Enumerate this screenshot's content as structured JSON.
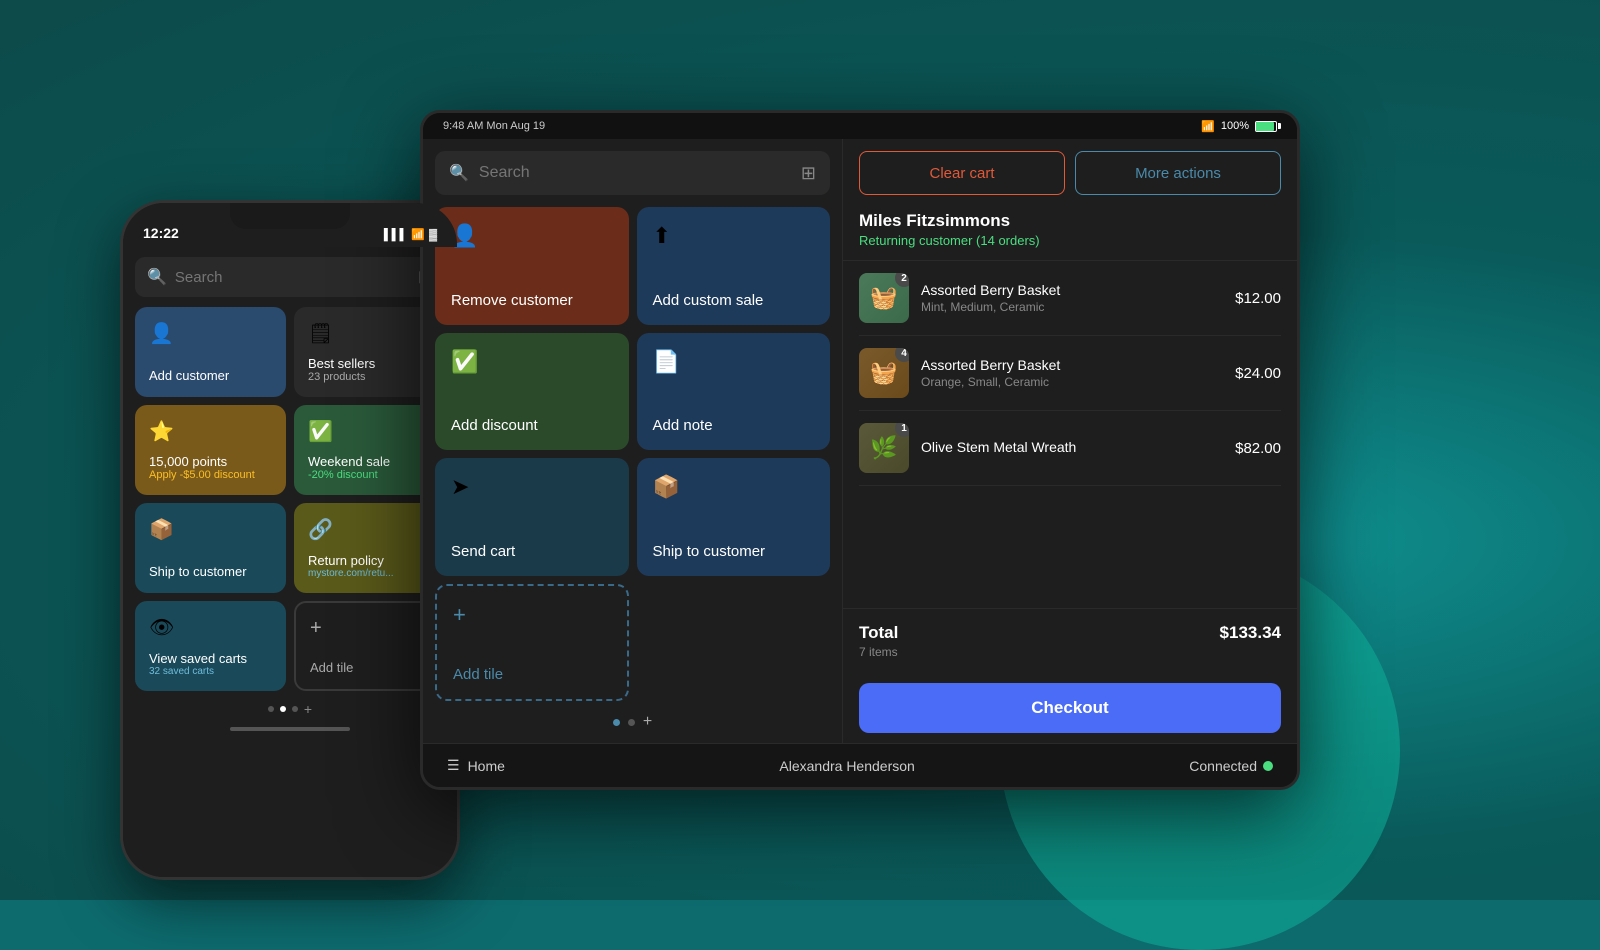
{
  "background": {
    "color": "#0a6060"
  },
  "phone": {
    "time": "12:22",
    "status_icons": "▶ ⟨⟩ 📶 🔋",
    "search_placeholder": "Search",
    "tiles": [
      {
        "id": "add-customer",
        "label": "Add customer",
        "icon": "👤",
        "color": "blue",
        "sublabel": ""
      },
      {
        "id": "best-sellers",
        "label": "Best sellers",
        "icon": "🗒",
        "color": "dark",
        "sublabel": "23 products"
      },
      {
        "id": "points",
        "label": "15,000 points",
        "icon": "⭐",
        "color": "gold",
        "sublabel": "Apply -$5.00 discount",
        "sublabel_color": "yellow"
      },
      {
        "id": "weekend-sale",
        "label": "Weekend sale",
        "icon": "✅",
        "color": "green",
        "sublabel": "-20% discount",
        "sublabel_color": "green"
      },
      {
        "id": "ship-to-customer",
        "label": "Ship to customer",
        "icon": "📦",
        "color": "teal",
        "sublabel": ""
      },
      {
        "id": "return-policy",
        "label": "Return policy",
        "icon": "🔗",
        "color": "olive",
        "sublabel": "mystore.com/retu...",
        "sublabel_color": "link"
      },
      {
        "id": "view-saved-carts",
        "label": "View saved carts",
        "icon": "👁",
        "color": "teal",
        "sublabel": "32 saved carts",
        "sublabel_color": "link"
      },
      {
        "id": "add-tile",
        "label": "Add tile",
        "icon": "+",
        "color": "add",
        "sublabel": ""
      }
    ]
  },
  "tablet": {
    "status_bar": {
      "time": "9:48 AM  Mon Aug 19",
      "wifi": "wifi",
      "battery": "100%"
    },
    "left_panel": {
      "search_placeholder": "Search",
      "tiles": [
        {
          "id": "remove-customer",
          "label": "Remove customer",
          "icon": "👤",
          "color": "red-brown"
        },
        {
          "id": "add-custom-sale",
          "label": "Add custom sale",
          "icon": "⬆",
          "color": "blue-dark"
        },
        {
          "id": "add-discount",
          "label": "Add discount",
          "icon": "✅",
          "color": "green-dark"
        },
        {
          "id": "add-note",
          "label": "Add note",
          "icon": "📄",
          "color": "blue-dark"
        },
        {
          "id": "send-cart",
          "label": "Send cart",
          "icon": "➤",
          "color": "teal-dark"
        },
        {
          "id": "ship-to-customer",
          "label": "Ship to customer",
          "icon": "📦",
          "color": "blue-dark"
        },
        {
          "id": "add-tile",
          "label": "Add tile",
          "icon": "+",
          "color": "add"
        }
      ]
    },
    "right_panel": {
      "clear_cart_label": "Clear cart",
      "more_actions_label": "More actions",
      "customer": {
        "name": "Miles Fitzsimmons",
        "status": "Returning customer (14 orders)"
      },
      "cart_items": [
        {
          "id": "item1",
          "name": "Assorted Berry Basket",
          "variant": "Mint, Medium, Ceramic",
          "price": "$12.00",
          "qty": 2,
          "img_type": "berry"
        },
        {
          "id": "item2",
          "name": "Assorted Berry Basket",
          "variant": "Orange, Small, Ceramic",
          "price": "$24.00",
          "qty": 4,
          "img_type": "berry-orange"
        },
        {
          "id": "item3",
          "name": "Olive Stem Metal Wreath",
          "variant": "",
          "price": "$82.00",
          "qty": 1,
          "img_type": "wreath"
        }
      ],
      "total": {
        "label": "Total",
        "items_count": "7 items",
        "amount": "$133.34"
      },
      "checkout_label": "Checkout"
    },
    "footer": {
      "home_label": "Home",
      "user_label": "Alexandra Henderson",
      "connected_label": "Connected"
    }
  }
}
